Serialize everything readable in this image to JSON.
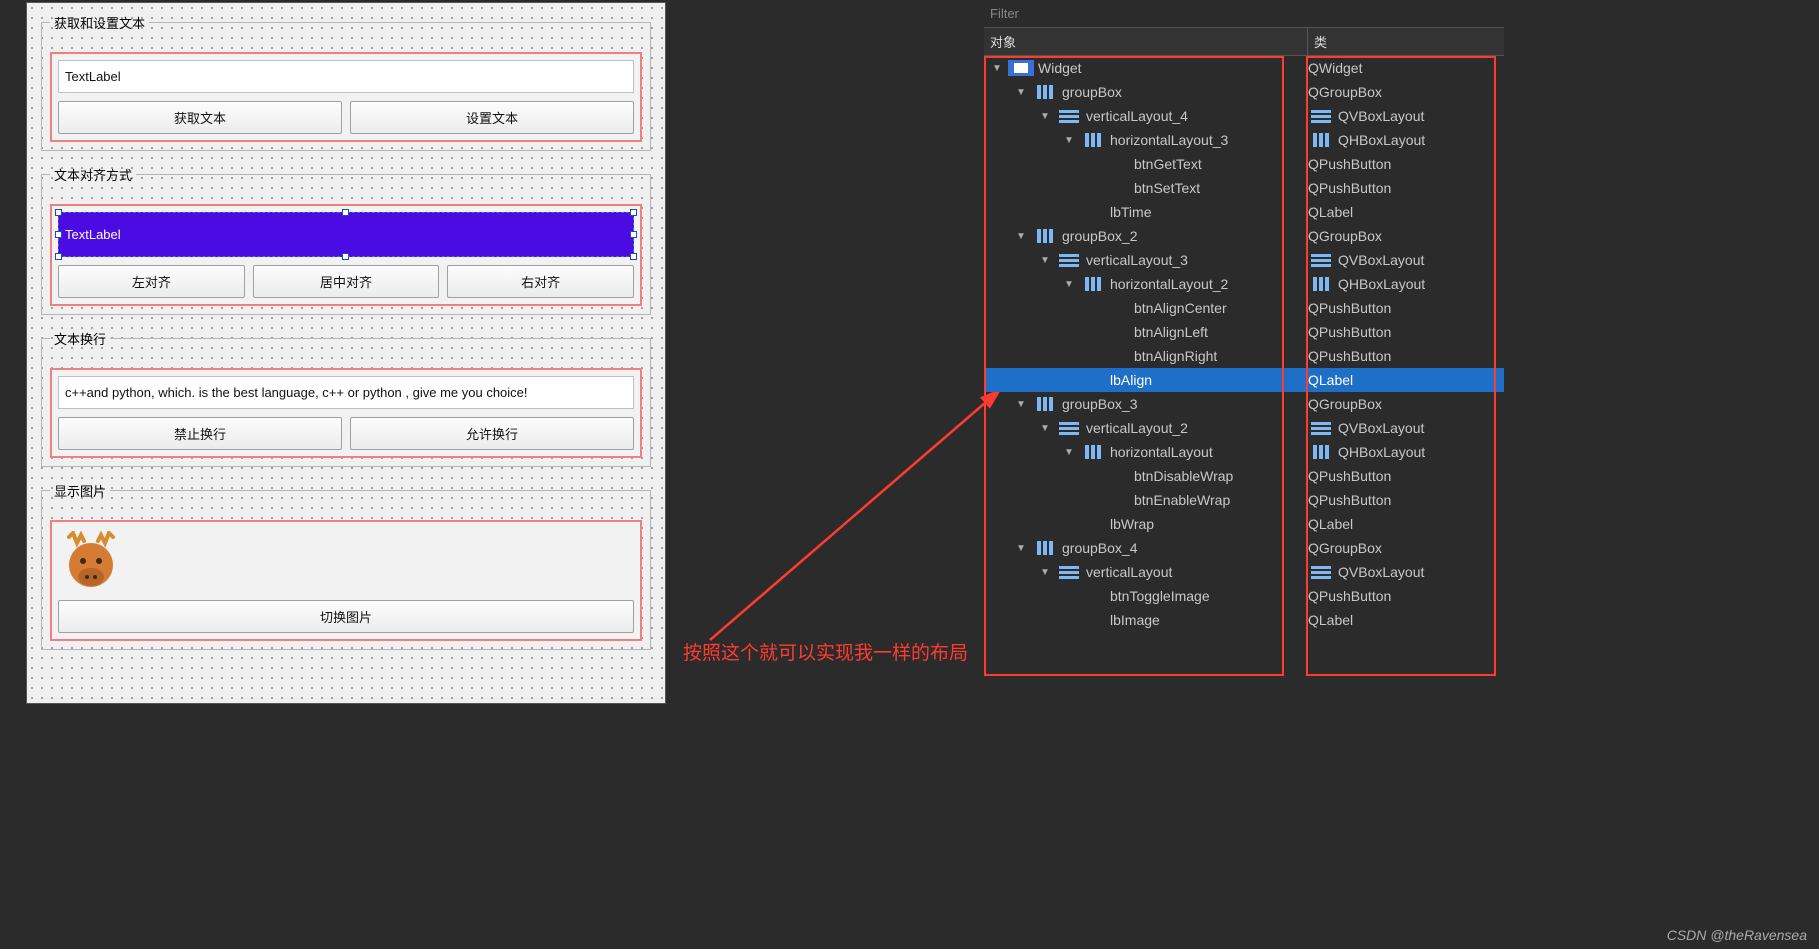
{
  "designer": {
    "group1": {
      "title": "获取和设置文本",
      "label_text": "TextLabel",
      "btn_get": "获取文本",
      "btn_set": "设置文本"
    },
    "group2": {
      "title": "文本对齐方式",
      "label_text": "TextLabel",
      "btn_left": "左对齐",
      "btn_center": "居中对齐",
      "btn_right": "右对齐"
    },
    "group3": {
      "title": "文本换行",
      "label_text": "c++and python, which. is the best language, c++ or python , give me you choice!",
      "btn_disable": "禁止换行",
      "btn_enable": "允许换行"
    },
    "group4": {
      "title": "显示图片",
      "btn_toggle": "切换图片",
      "icon_name": "moose-icon"
    }
  },
  "annotation": "按照这个就可以实现我一样的布局",
  "inspector": {
    "filter_placeholder": "Filter",
    "header_object": "对象",
    "header_class": "类",
    "selected": "lbAlign",
    "tree": [
      {
        "depth": 0,
        "exp": "▼",
        "icon": "w",
        "name": "Widget",
        "cls": "QWidget"
      },
      {
        "depth": 1,
        "exp": "▼",
        "icon": "h",
        "name": "groupBox",
        "cls": "QGroupBox"
      },
      {
        "depth": 2,
        "exp": "▼",
        "icon": "v",
        "name": "verticalLayout_4",
        "cls": "QVBoxLayout",
        "clsIcon": "v"
      },
      {
        "depth": 3,
        "exp": "▼",
        "icon": "h",
        "name": "horizontalLayout_3",
        "cls": "QHBoxLayout",
        "clsIcon": "h"
      },
      {
        "depth": 4,
        "exp": "",
        "icon": "",
        "name": "btnGetText",
        "cls": "QPushButton"
      },
      {
        "depth": 4,
        "exp": "",
        "icon": "",
        "name": "btnSetText",
        "cls": "QPushButton"
      },
      {
        "depth": 3,
        "exp": "",
        "icon": "",
        "name": "lbTime",
        "cls": "QLabel"
      },
      {
        "depth": 1,
        "exp": "▼",
        "icon": "h",
        "name": "groupBox_2",
        "cls": "QGroupBox"
      },
      {
        "depth": 2,
        "exp": "▼",
        "icon": "v",
        "name": "verticalLayout_3",
        "cls": "QVBoxLayout",
        "clsIcon": "v"
      },
      {
        "depth": 3,
        "exp": "▼",
        "icon": "h",
        "name": "horizontalLayout_2",
        "cls": "QHBoxLayout",
        "clsIcon": "h"
      },
      {
        "depth": 4,
        "exp": "",
        "icon": "",
        "name": "btnAlignCenter",
        "cls": "QPushButton"
      },
      {
        "depth": 4,
        "exp": "",
        "icon": "",
        "name": "btnAlignLeft",
        "cls": "QPushButton"
      },
      {
        "depth": 4,
        "exp": "",
        "icon": "",
        "name": "btnAlignRight",
        "cls": "QPushButton"
      },
      {
        "depth": 3,
        "exp": "",
        "icon": "",
        "name": "lbAlign",
        "cls": "QLabel"
      },
      {
        "depth": 1,
        "exp": "▼",
        "icon": "h",
        "name": "groupBox_3",
        "cls": "QGroupBox"
      },
      {
        "depth": 2,
        "exp": "▼",
        "icon": "v",
        "name": "verticalLayout_2",
        "cls": "QVBoxLayout",
        "clsIcon": "v"
      },
      {
        "depth": 3,
        "exp": "▼",
        "icon": "h",
        "name": "horizontalLayout",
        "cls": "QHBoxLayout",
        "clsIcon": "h"
      },
      {
        "depth": 4,
        "exp": "",
        "icon": "",
        "name": "btnDisableWrap",
        "cls": "QPushButton"
      },
      {
        "depth": 4,
        "exp": "",
        "icon": "",
        "name": "btnEnableWrap",
        "cls": "QPushButton"
      },
      {
        "depth": 3,
        "exp": "",
        "icon": "",
        "name": "lbWrap",
        "cls": "QLabel"
      },
      {
        "depth": 1,
        "exp": "▼",
        "icon": "h",
        "name": "groupBox_4",
        "cls": "QGroupBox"
      },
      {
        "depth": 2,
        "exp": "▼",
        "icon": "v",
        "name": "verticalLayout",
        "cls": "QVBoxLayout",
        "clsIcon": "v"
      },
      {
        "depth": 3,
        "exp": "",
        "icon": "",
        "name": "btnToggleImage",
        "cls": "QPushButton"
      },
      {
        "depth": 3,
        "exp": "",
        "icon": "",
        "name": "lbImage",
        "cls": "QLabel"
      }
    ]
  },
  "watermark": "CSDN @theRavensea"
}
